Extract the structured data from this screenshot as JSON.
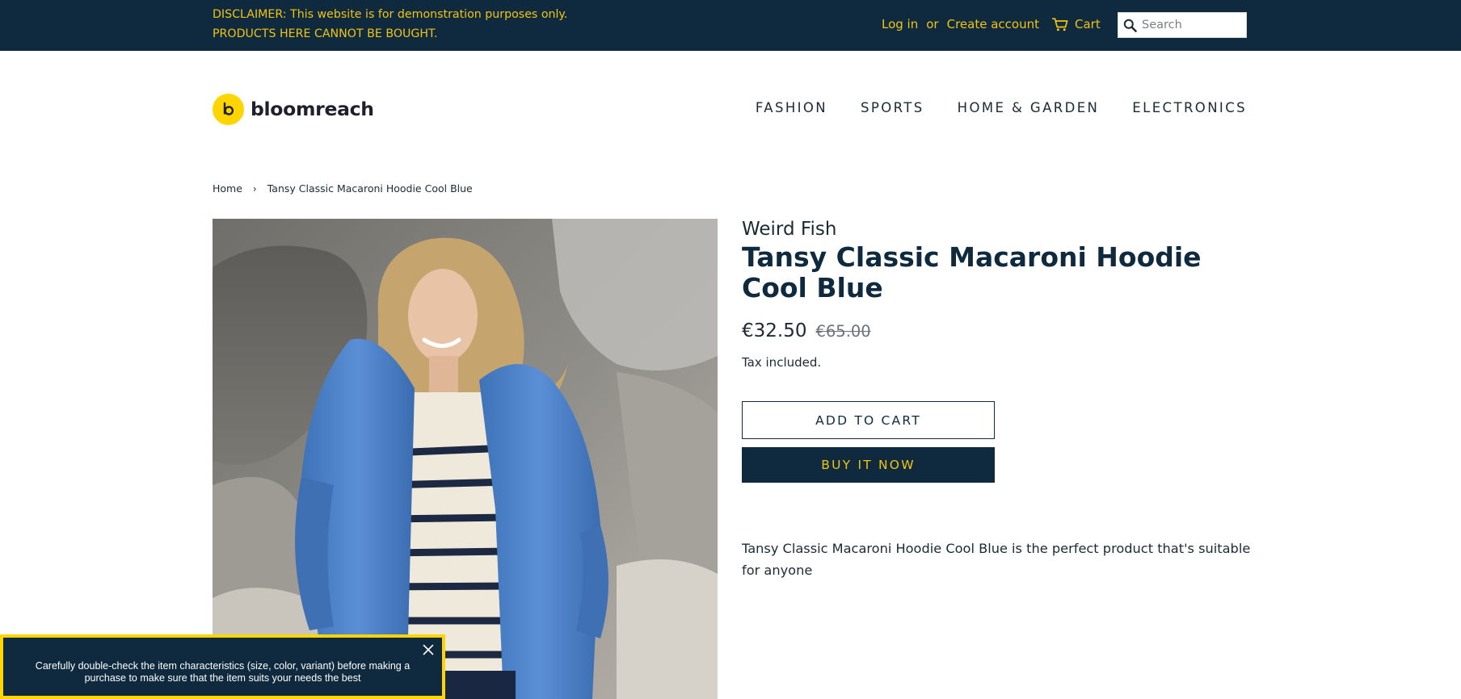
{
  "topbar": {
    "disclaimer": "DISCLAIMER: This website is for demonstration purposes only. PRODUCTS HERE CANNOT BE BOUGHT.",
    "login": "Log in",
    "or": "or",
    "create_account": "Create account",
    "cart": "Cart",
    "search_placeholder": "Search",
    "icons": {
      "cart": "cart-icon",
      "search": "search-icon"
    }
  },
  "header": {
    "logo_text": "bloomreach",
    "logo_icon": "bloomreach-logo-icon",
    "nav": [
      "FASHION",
      "SPORTS",
      "HOME & GARDEN",
      "ELECTRONICS"
    ]
  },
  "breadcrumb": {
    "home": "Home",
    "separator": "›",
    "current": "Tansy Classic Macaroni Hoodie Cool Blue"
  },
  "product": {
    "vendor": "Weird Fish",
    "title": "Tansy Classic Macaroni Hoodie Cool Blue",
    "price_sale": "€32.50",
    "price_compare": "€65.00",
    "tax_note": "Tax included.",
    "add_to_cart": "ADD TO CART",
    "buy_now": "BUY IT NOW",
    "description": "Tansy Classic Macaroni Hoodie Cool Blue is the perfect product that's suitable for anyone",
    "image_subject": "product-photo-woman-in-blue-hoodie"
  },
  "toast": {
    "message": "Carefully double-check the item characteristics (size, color, variant) before making a purchase to make sure that the item suits your needs the best",
    "close_icon": "close-icon"
  },
  "colors": {
    "navy": "#0f2a3e",
    "accent_yellow": "#f1c40f",
    "logo_yellow": "#ffd500",
    "compare_price_gray": "#69727b",
    "white": "#ffffff"
  }
}
